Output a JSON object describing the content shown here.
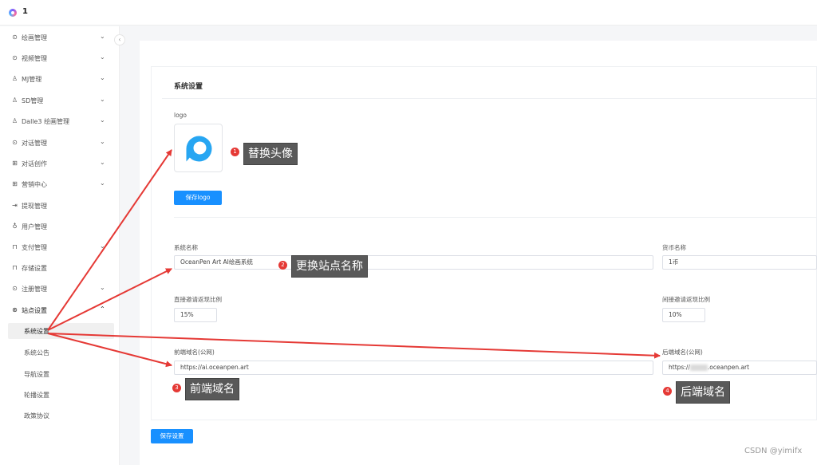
{
  "app": {
    "title": "1"
  },
  "sidebar": {
    "collapse_glyph": "‹",
    "items": [
      {
        "label": "绘画管理",
        "icon": "chat-icon",
        "glyph": "⊙",
        "has_chevron": true
      },
      {
        "label": "视频管理",
        "icon": "chat-icon",
        "glyph": "⊙",
        "has_chevron": true
      },
      {
        "label": "MJ管理",
        "icon": "flask-icon",
        "glyph": "♙",
        "has_chevron": true
      },
      {
        "label": "SD管理",
        "icon": "flask-icon",
        "glyph": "♙",
        "has_chevron": true
      },
      {
        "label": "Dalle3 绘画管理",
        "icon": "flask-icon",
        "glyph": "♙",
        "has_chevron": true
      },
      {
        "label": "对话管理",
        "icon": "chat-icon",
        "glyph": "⊙",
        "has_chevron": true
      },
      {
        "label": "对话创作",
        "icon": "grid-icon",
        "glyph": "⊞",
        "has_chevron": true
      },
      {
        "label": "营销中心",
        "icon": "grid-icon",
        "glyph": "⊞",
        "has_chevron": true
      },
      {
        "label": "提现管理",
        "icon": "export-icon",
        "glyph": "⇥",
        "has_chevron": false
      },
      {
        "label": "用户管理",
        "icon": "user-icon",
        "glyph": "♁",
        "has_chevron": false
      },
      {
        "label": "支付管理",
        "icon": "bag-icon",
        "glyph": "⊓",
        "has_chevron": true
      },
      {
        "label": "存储设置",
        "icon": "bag-icon",
        "glyph": "⊓",
        "has_chevron": false
      },
      {
        "label": "注册管理",
        "icon": "chat-icon",
        "glyph": "⊙",
        "has_chevron": true
      },
      {
        "label": "站点设置",
        "icon": "settings-icon",
        "glyph": "⊛",
        "has_chevron": true,
        "expanded": true
      }
    ],
    "subitems": [
      {
        "label": "系统设置",
        "active": true
      },
      {
        "label": "系统公告"
      },
      {
        "label": "导航设置"
      },
      {
        "label": "轮播设置"
      },
      {
        "label": "政策协议"
      }
    ]
  },
  "settings": {
    "title": "系统设置",
    "logo_label": "logo",
    "save_logo": "保存logo",
    "site_name_label": "系统名称",
    "site_name_value": "OceanPen Art AI绘画系统",
    "currency_label": "货币名称",
    "currency_value": "1币",
    "direct_ratio_label": "直接邀请返现比例",
    "direct_ratio_value": "15%",
    "indirect_ratio_label": "间接邀请返现比例",
    "indirect_ratio_value": "10%",
    "frontend_label": "前端域名(公网)",
    "frontend_value": "https://ai.oceanpen.art",
    "backend_label": "后端域名(公网)",
    "backend_prefix": "https://",
    "backend_suffix": ".oceanpen.art",
    "save_settings": "保存设置"
  },
  "annotations": [
    {
      "num": "1",
      "text": "替换头像"
    },
    {
      "num": "2",
      "text": "更换站点名称"
    },
    {
      "num": "3",
      "text": "前端域名"
    },
    {
      "num": "4",
      "text": "后端域名"
    }
  ],
  "watermark": "CSDN @yimifx",
  "colors": {
    "primary": "#1890ff",
    "arrow": "#e53935",
    "logo_blue": "#27a6f2",
    "callout_bg": "#595959"
  }
}
